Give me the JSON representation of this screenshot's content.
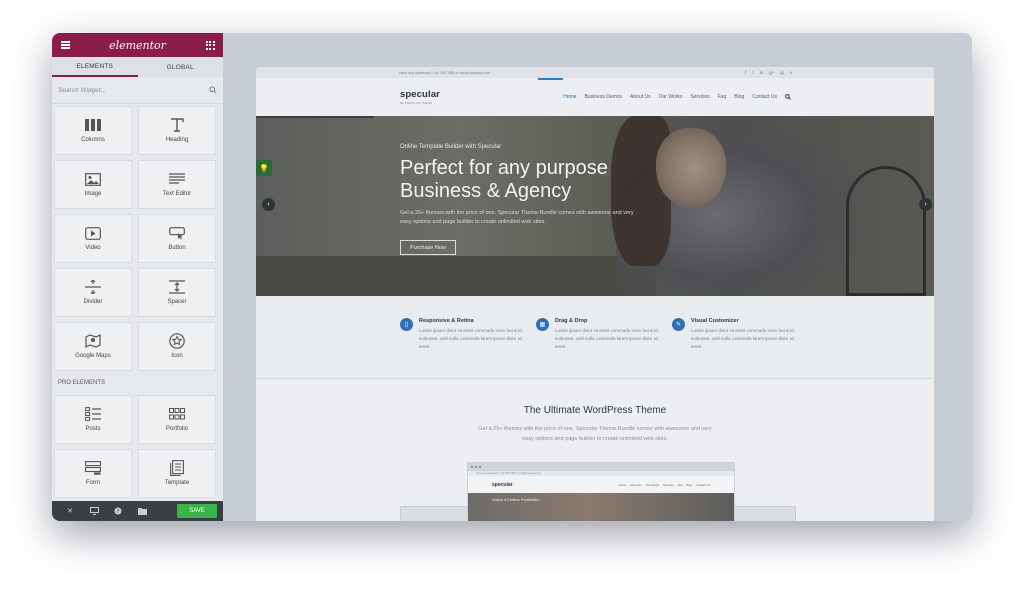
{
  "sidebar": {
    "logo": "elementor",
    "tabs": [
      {
        "label": "ELEMENTS",
        "active": true
      },
      {
        "label": "GLOBAL",
        "active": false
      }
    ],
    "search_placeholder": "Search Widget...",
    "widgets": [
      {
        "label": "Columns",
        "icon": "columns-icon"
      },
      {
        "label": "Heading",
        "icon": "heading-icon"
      },
      {
        "label": "Image",
        "icon": "image-icon"
      },
      {
        "label": "Text Editor",
        "icon": "text-editor-icon"
      },
      {
        "label": "Video",
        "icon": "video-icon"
      },
      {
        "label": "Button",
        "icon": "button-icon"
      },
      {
        "label": "Divider",
        "icon": "divider-icon"
      },
      {
        "label": "Spacer",
        "icon": "spacer-icon"
      },
      {
        "label": "Google Maps",
        "icon": "map-icon"
      },
      {
        "label": "Icon",
        "icon": "star-icon"
      }
    ],
    "pro_label": "PRO ELEMENTS",
    "pro_widgets": [
      {
        "label": "Posts",
        "icon": "posts-icon"
      },
      {
        "label": "Portfolio",
        "icon": "portfolio-icon"
      },
      {
        "label": "Form",
        "icon": "form-icon"
      },
      {
        "label": "Template",
        "icon": "template-icon"
      }
    ],
    "footer": {
      "save_label": "SAVE"
    }
  },
  "site": {
    "topbar_text": "Have any questions? +44 7547 888 or info@company.com",
    "social": [
      "f",
      "t",
      "in",
      "g+",
      "ig",
      "v"
    ],
    "brand": "specular",
    "brand_tagline": "BUSINESS WP THEME",
    "nav": [
      {
        "label": "Home",
        "active": true
      },
      {
        "label": "Business Demos",
        "active": false
      },
      {
        "label": "About Us",
        "active": false
      },
      {
        "label": "Our Works",
        "active": false
      },
      {
        "label": "Services",
        "active": false
      },
      {
        "label": "Faq",
        "active": false
      },
      {
        "label": "Blog",
        "active": false
      },
      {
        "label": "Contact Us",
        "active": false
      }
    ],
    "hero": {
      "kicker": "Online Template Builder with Specular",
      "title_line1": "Perfect for any purpose",
      "title_line2": "Business & Agency",
      "description": "Get a 25+ themes with the price of one. Specular Theme-Bundle comes with awesome and very easy options and page builder to create unlimited web sites.",
      "button": "Purchase Now"
    },
    "features": [
      {
        "title": "Responsive & Retina",
        "text": "Lorem ipsum dolor sit amet commodo enim lacus id vulputate, velit nulla commodo lorem ipsum dolor sit amet."
      },
      {
        "title": "Drag & Drop",
        "text": "Lorem ipsum dolor sit amet commodo enim lacus id vulputate, velit nulla commodo lorem ipsum dolor sit amet."
      },
      {
        "title": "Visual Customizer",
        "text": "Lorem ipsum dolor sit amet commodo enim lacus id vulputate, velit nulla commodo lorem ipsum dolor sit amet."
      }
    ],
    "section": {
      "title": "The Ultimate WordPress Theme",
      "description": "Get a 25+ themes with the price of one. Specular Theme-Bundle comes with awesome and very easy options and page builder to create unlimited web sites."
    },
    "mockup": {
      "brand": "specular",
      "nav": [
        "Home",
        "About Us",
        "Our Works",
        "Services",
        "Faq",
        "Blog",
        "Contact Us"
      ],
      "hero_text": "Unique & Endless Possibilities"
    }
  },
  "colors": {
    "elementor_brand": "#8b1e49",
    "save_green": "#39b54a",
    "accent_blue": "#2f6fb3"
  }
}
